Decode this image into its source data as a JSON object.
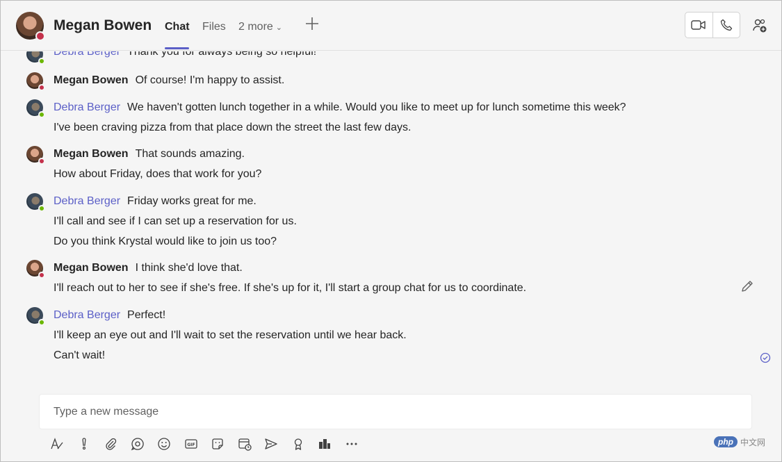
{
  "header": {
    "title": "Megan Bowen",
    "tabs": [
      {
        "label": "Chat",
        "active": true
      },
      {
        "label": "Files",
        "active": false
      },
      {
        "label": "2 more",
        "active": false
      }
    ],
    "add_tab_icon": "plus-icon",
    "video_call_icon": "video-camera-icon",
    "audio_call_icon": "phone-icon",
    "people_icon": "add-people-icon"
  },
  "messages": [
    {
      "sender": "Debra Berger",
      "lines": [
        "Thank you for always being so helpful!"
      ]
    },
    {
      "sender": "Megan Bowen",
      "lines": [
        "Of course! I'm happy to assist."
      ]
    },
    {
      "sender": "Debra Berger",
      "lines": [
        "We haven't gotten lunch together in a while. Would you like to meet up for lunch sometime this week?",
        "I've been craving pizza from that place down the street the last few days."
      ]
    },
    {
      "sender": "Megan Bowen",
      "lines": [
        "That sounds amazing.",
        "How about Friday, does that work for you?"
      ]
    },
    {
      "sender": "Debra Berger",
      "lines": [
        "Friday works great for me.",
        "I'll call and see if I can set up a reservation for us.",
        "Do you think Krystal would like to join us too?"
      ]
    },
    {
      "sender": "Megan Bowen",
      "lines": [
        "I think she'd love that.",
        "I'll reach out to her to see if she's free. If she's up for it, I'll start a group chat for us to coordinate."
      ]
    },
    {
      "sender": "Debra Berger",
      "lines": [
        "Perfect!",
        "I'll keep an eye out and I'll wait to set the reservation until we hear back.",
        "Can't wait!"
      ]
    }
  ],
  "compose": {
    "placeholder": "Type a new message"
  },
  "toolbar": {
    "icons": [
      "format-icon",
      "important-icon",
      "attach-icon",
      "loop-icon",
      "emoji-icon",
      "gif-icon",
      "sticker-icon",
      "schedule-meeting-icon",
      "send-icon",
      "praise-icon",
      "apps-icon",
      "more-icon"
    ]
  },
  "watermark": {
    "logo": "php",
    "text": "中文网"
  },
  "colors": {
    "accent": "#5b5fc7",
    "busy": "#c4314b",
    "available": "#6bb700"
  }
}
